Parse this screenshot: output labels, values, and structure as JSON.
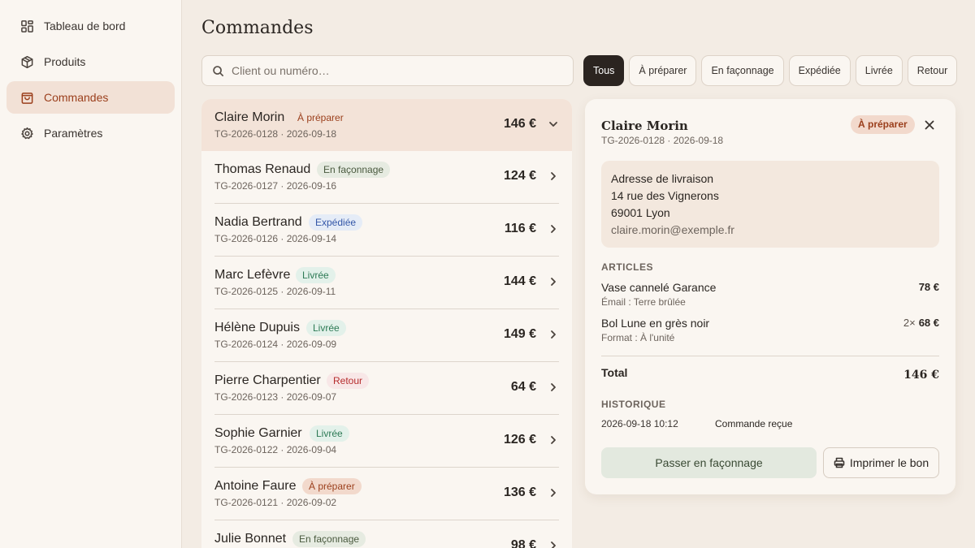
{
  "sidebar": {
    "items": [
      {
        "label": "Tableau de bord",
        "icon": "dashboard-icon",
        "active": false
      },
      {
        "label": "Produits",
        "icon": "box-icon",
        "active": false
      },
      {
        "label": "Commandes",
        "icon": "shopping-bag-icon",
        "active": true
      },
      {
        "label": "Paramètres",
        "icon": "gear-icon",
        "active": false
      }
    ]
  },
  "header": {
    "title": "Commandes"
  },
  "search": {
    "placeholder": "Client ou numéro…",
    "value": ""
  },
  "filters": [
    {
      "label": "Tous",
      "active": true
    },
    {
      "label": "À préparer",
      "active": false
    },
    {
      "label": "En façonnage",
      "active": false
    },
    {
      "label": "Expédiée",
      "active": false
    },
    {
      "label": "Livrée",
      "active": false
    },
    {
      "label": "Retour",
      "active": false
    }
  ],
  "orders": [
    {
      "name": "Claire Morin",
      "status": "À préparer",
      "status_kind": "selected-prep",
      "meta": "TG-2026-0128 · 2026-09-18",
      "amount": "146 €",
      "selected": true
    },
    {
      "name": "Thomas Renaud",
      "status": "En façonnage",
      "status_kind": "facon",
      "meta": "TG-2026-0127 · 2026-09-16",
      "amount": "124 €",
      "selected": false
    },
    {
      "name": "Nadia Bertrand",
      "status": "Expédiée",
      "status_kind": "exped",
      "meta": "TG-2026-0126 · 2026-09-14",
      "amount": "116 €",
      "selected": false
    },
    {
      "name": "Marc Lefèvre",
      "status": "Livrée",
      "status_kind": "livree",
      "meta": "TG-2026-0125 · 2026-09-11",
      "amount": "144 €",
      "selected": false
    },
    {
      "name": "Hélène Dupuis",
      "status": "Livrée",
      "status_kind": "livree",
      "meta": "TG-2026-0124 · 2026-09-09",
      "amount": "149 €",
      "selected": false
    },
    {
      "name": "Pierre Charpentier",
      "status": "Retour",
      "status_kind": "retour",
      "meta": "TG-2026-0123 · 2026-09-07",
      "amount": "64 €",
      "selected": false
    },
    {
      "name": "Sophie Garnier",
      "status": "Livrée",
      "status_kind": "livree",
      "meta": "TG-2026-0122 · 2026-09-04",
      "amount": "126 €",
      "selected": false
    },
    {
      "name": "Antoine Faure",
      "status": "À préparer",
      "status_kind": "prep",
      "meta": "TG-2026-0121 · 2026-09-02",
      "amount": "136 €",
      "selected": false
    },
    {
      "name": "Julie Bonnet",
      "status": "En façonnage",
      "status_kind": "facon",
      "meta": "",
      "amount": "98 €",
      "selected": false
    }
  ],
  "detail": {
    "name": "Claire Morin",
    "meta": "TG-2026-0128 · 2026-09-18",
    "status": "À préparer",
    "address": {
      "label": "Adresse de livraison",
      "line1": "14 rue des Vignerons",
      "line2": "69001 Lyon",
      "email": "claire.morin@exemple.fr"
    },
    "articles_title": "ARTICLES",
    "articles": [
      {
        "name": "Vase cannelé Garance",
        "option": "Émail : Terre brûlée",
        "qty": "",
        "price": "78 €"
      },
      {
        "name": "Bol Lune en grès noir",
        "option": "Format : À l'unité",
        "qty": "2×",
        "price": "68 €"
      }
    ],
    "total_label": "Total",
    "total_value": "146 €",
    "history_title": "HISTORIQUE",
    "history": [
      {
        "date": "2026-09-18 10:12",
        "event": "Commande reçue"
      }
    ],
    "primary_action": "Passer en façonnage",
    "secondary_action": "Imprimer le bon"
  },
  "colors": {
    "accent": "#9b3f1c",
    "background": "#f3ece4",
    "panel": "#faf6f1",
    "selected_row": "#f3e3d8"
  }
}
